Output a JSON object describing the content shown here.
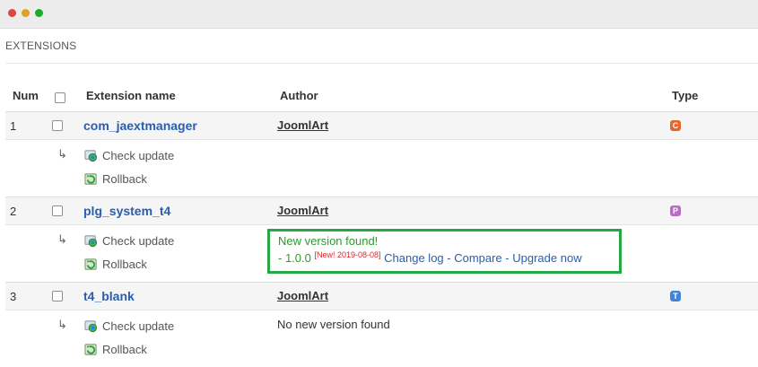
{
  "section": {
    "title": "EXTENSIONS"
  },
  "table": {
    "headers": {
      "num": "Num",
      "name": "Extension name",
      "author": "Author",
      "type": "Type"
    }
  },
  "actions": {
    "check": "Check update",
    "rollback": "Rollback",
    "arrow": "↳"
  },
  "rows": [
    {
      "num": "1",
      "name": "com_jaextmanager",
      "author": "JoomlArt",
      "type": "C",
      "type_color": "#e8642b"
    },
    {
      "num": "2",
      "name": "plg_system_t4",
      "author": "JoomlArt",
      "type": "P",
      "type_color": "#b86cc3",
      "update": {
        "found": "New version found!",
        "version": "- 1.0.0",
        "new_tag": "[New! 2019-08-08]",
        "changelog": "Change log",
        "compare": "Compare",
        "upgrade": "Upgrade now",
        "sep": " - "
      }
    },
    {
      "num": "3",
      "name": "t4_blank",
      "author": "JoomlArt",
      "type": "T",
      "type_color": "#3f87d6",
      "status": "No new version found"
    }
  ]
}
